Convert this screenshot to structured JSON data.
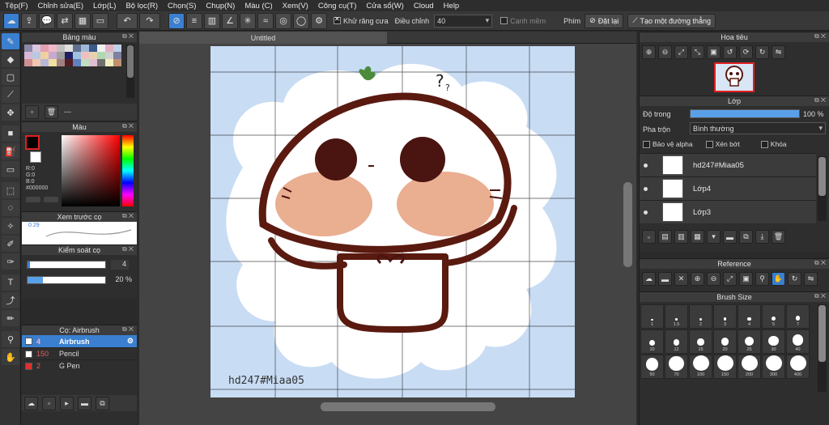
{
  "menu": [
    "Tệp(F)",
    "Chỉnh sửa(E)",
    "Lớp(L)",
    "Bộ lọc(R)",
    "Chọn(S)",
    "Chụp(N)",
    "Màu (C)",
    "Xem(V)",
    "Công cụ(T)",
    "Cửa sổ(W)",
    "Cloud",
    "Help"
  ],
  "toolbar": {
    "antialias_label": "Khử răng cưa",
    "adjust_label": "Điều chỉnh",
    "adjust_value": "40",
    "soft_edge_label": "Cạnh mềm",
    "key_label": "Phím",
    "reset_label": "Đặt lại",
    "create_line_label": "Tạo một đường thẳng"
  },
  "palette": {
    "title": "Bảng màu",
    "dashes": "---",
    "swatches": [
      "#8a8aa8",
      "#d8c8e0",
      "#e4a0b0",
      "#f0b8c8",
      "#c0c0c0",
      "#e0e0e0",
      "#607090",
      "#a0b8d8",
      "#3a5a8a",
      "#f0f0f0",
      "#e0b0c0",
      "#c0d0e8",
      "#d8b8d8",
      "#b8c8e0",
      "#f0d0a0",
      "#c8a8d0",
      "#a0a0a0",
      "#202060",
      "#a0c0e0",
      "#f0c0c0",
      "#e8d0b0",
      "#b0d8b0",
      "#d0d0d0",
      "#8080a0",
      "#d09090",
      "#f0c8b0",
      "#b8b8d8",
      "#f0e0a0",
      "#a08080",
      "#502020",
      "#6080c0",
      "#c0e0c0",
      "#e0c0d0",
      "#707070",
      "#f0f0c0",
      "#c09070"
    ]
  },
  "color": {
    "title": "Màu",
    "r": "R:0",
    "g": "G:0",
    "b": "B:0",
    "hex": "#000000",
    "primary": "#000000"
  },
  "brush_preview": {
    "title": "Xem trước cọ",
    "size": "0.29"
  },
  "brush_control": {
    "title": "Kiểm soát cọ",
    "size_value": "4",
    "opacity_value": "20 %",
    "opacity_fraction": 0.2
  },
  "brush": {
    "title": "Cọ: Airbrush",
    "items": [
      {
        "size": "4",
        "name": "Airbrush",
        "color": "#ffffff",
        "active": true
      },
      {
        "size": "150",
        "name": "Pencil",
        "color": "#ffffff",
        "active": false
      },
      {
        "size": "2",
        "name": "G Pen",
        "color": "#e03030",
        "active": false
      }
    ]
  },
  "document": {
    "tab": "Untitled",
    "watermark": "hd247#Miaa05"
  },
  "navigator": {
    "title": "Hoa tiêu"
  },
  "layer": {
    "title": "Lớp",
    "opacity_label": "Độ trong",
    "opacity_value": "100 %",
    "opacity_fraction": 1.0,
    "blend_label": "Pha trộn",
    "blend_value": "Bình thường",
    "protect_alpha": "Bảo vệ alpha",
    "clipping": "Xén bớt",
    "lock": "Khóa",
    "layers": [
      {
        "name": "hd247#Miaa05"
      },
      {
        "name": "Lớp4"
      },
      {
        "name": "Lớp3"
      }
    ]
  },
  "reference": {
    "title": "Reference"
  },
  "brush_size": {
    "title": "Brush Size",
    "sizes": [
      "1",
      "1.5",
      "2",
      "3",
      "4",
      "5",
      "7",
      "10",
      "12",
      "15",
      "20",
      "25",
      "30",
      "40",
      "50",
      "70",
      "100",
      "150",
      "200",
      "300",
      "400"
    ]
  }
}
